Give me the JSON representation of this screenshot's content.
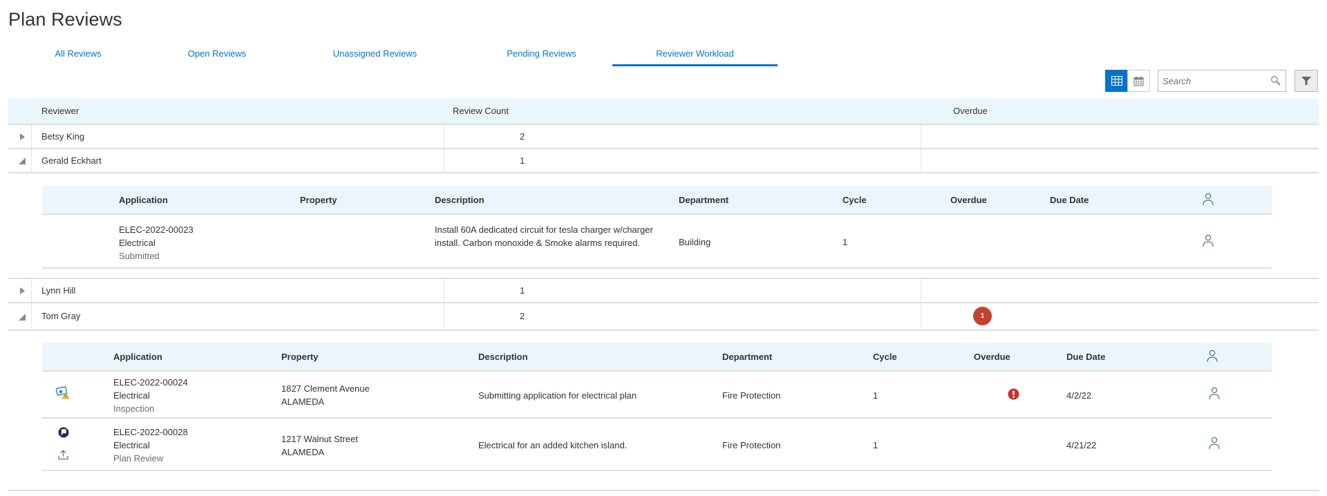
{
  "page": {
    "title": "Plan Reviews"
  },
  "tabs": [
    {
      "label": "All Reviews",
      "active": false
    },
    {
      "label": "Open Reviews",
      "active": false
    },
    {
      "label": "Unassigned Reviews",
      "active": false
    },
    {
      "label": "Pending Reviews",
      "active": false
    },
    {
      "label": "Reviewer Workload",
      "active": true
    }
  ],
  "toolbar": {
    "views": [
      {
        "icon": "grid-view-icon",
        "active": true
      },
      {
        "icon": "calendar-view-icon",
        "active": false
      }
    ],
    "search": {
      "value": "",
      "placeholder": "Search",
      "icon": "search-icon"
    },
    "filter": {
      "icon": "filter-icon"
    }
  },
  "colors": {
    "accent": "#0572ce",
    "header_bg": "#ebf6fc",
    "alert": "#c8402f",
    "person_icon": "#4f7a8c"
  },
  "grid": {
    "columns": [
      "Reviewer",
      "Review Count",
      "Overdue"
    ],
    "rows": [
      {
        "reviewer": "Betsy King",
        "count": "2",
        "overdue": "",
        "expanded": false
      },
      {
        "reviewer": "Gerald Eckhart",
        "count": "1",
        "overdue": "",
        "expanded": true,
        "detail": {
          "columns": [
            "Application",
            "Property",
            "Description",
            "Department",
            "Cycle",
            "Overdue",
            "Due Date"
          ],
          "assign_icon": "person-icon",
          "rows": [
            {
              "icons": [],
              "application_id": "ELEC-2022-00023",
              "application_type": "Electrical",
              "application_status": "Submitted",
              "property_line1": "",
              "property_line2": "",
              "description": "Install 60A dedicated circuit for tesla charger w/charger install. Carbon monoxide & Smoke alarms required.",
              "department": "Building",
              "cycle": "1",
              "overdue": false,
              "due_date": ""
            }
          ]
        }
      },
      {
        "reviewer": "Lynn Hill",
        "count": "1",
        "overdue": "",
        "expanded": false
      },
      {
        "reviewer": "Tom Gray",
        "count": "2",
        "overdue": "1",
        "expanded": true,
        "detail": {
          "columns": [
            "Application",
            "Property",
            "Description",
            "Department",
            "Cycle",
            "Overdue",
            "Due Date"
          ],
          "assign_icon": "person-icon",
          "rows": [
            {
              "icons": [
                "fee-warning-icon"
              ],
              "application_id": "ELEC-2022-00024",
              "application_type": "Electrical",
              "application_status": "Inspection",
              "property_line1": "1827 Clement Avenue",
              "property_line2": "ALAMEDA",
              "description": "Submitting application for electrical plan",
              "department": "Fire Protection",
              "cycle": "1",
              "overdue": true,
              "due_date": "4/2/22"
            },
            {
              "icons": [
                "flag-icon",
                "upload-icon"
              ],
              "application_id": "ELEC-2022-00028",
              "application_type": "Electrical",
              "application_status": "Plan Review",
              "property_line1": "1217 Walnut Street",
              "property_line2": "ALAMEDA",
              "description": "Electrical for an added kitchen island.",
              "department": "Fire Protection",
              "cycle": "1",
              "overdue": false,
              "due_date": "4/21/22"
            }
          ]
        }
      }
    ]
  }
}
